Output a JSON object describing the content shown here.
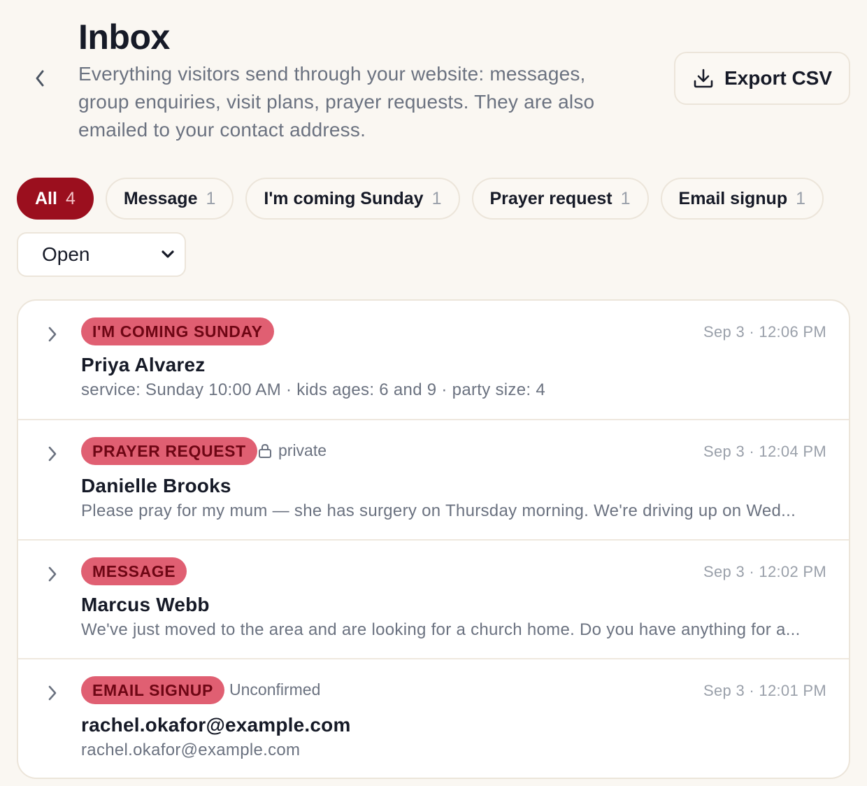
{
  "header": {
    "title": "Inbox",
    "description": "Everything visitors send through your website: messages, group enquiries, visit plans, prayer requests. They are also emailed to your contact address.",
    "back_icon": "chevron-left-icon",
    "export_label": "Export CSV",
    "export_icon": "download-icon"
  },
  "filters": [
    {
      "label": "All",
      "count": "4",
      "active": true
    },
    {
      "label": "Message",
      "count": "1",
      "active": false
    },
    {
      "label": "I'm coming Sunday",
      "count": "1",
      "active": false
    },
    {
      "label": "Prayer request",
      "count": "1",
      "active": false
    },
    {
      "label": "Email signup",
      "count": "1",
      "active": false
    }
  ],
  "status_filter": {
    "selected": "Open",
    "icon": "chevron-down-icon"
  },
  "colors": {
    "accent": "#9b0f1e",
    "tag_background": "#e05f72",
    "tag_text": "#6e0614",
    "page_background": "#faf7f2"
  },
  "submissions": [
    {
      "type": "I'm coming Sunday",
      "meta": "",
      "time": "Sep 3 · 12:06 PM",
      "name": "Priya Alvarez",
      "summary": "service: Sunday 10:00 AM · kids ages: 6 and 9 · party size: 4"
    },
    {
      "type": "Prayer request",
      "meta": "private",
      "meta_icon": "lock-icon",
      "time": "Sep 3 · 12:04 PM",
      "name": "Danielle Brooks",
      "summary": "Please pray for my mum — she has surgery on Thursday morning. We're driving up on Wed..."
    },
    {
      "type": "Message",
      "meta": "",
      "time": "Sep 3 · 12:02 PM",
      "name": "Marcus Webb",
      "summary": "We've just moved to the area and are looking for a church home. Do you have anything for a..."
    },
    {
      "type": "Email signup",
      "meta": "Unconfirmed",
      "time": "Sep 3 · 12:01 PM",
      "name": "rachel.okafor@example.com",
      "summary": "rachel.okafor@example.com"
    }
  ]
}
